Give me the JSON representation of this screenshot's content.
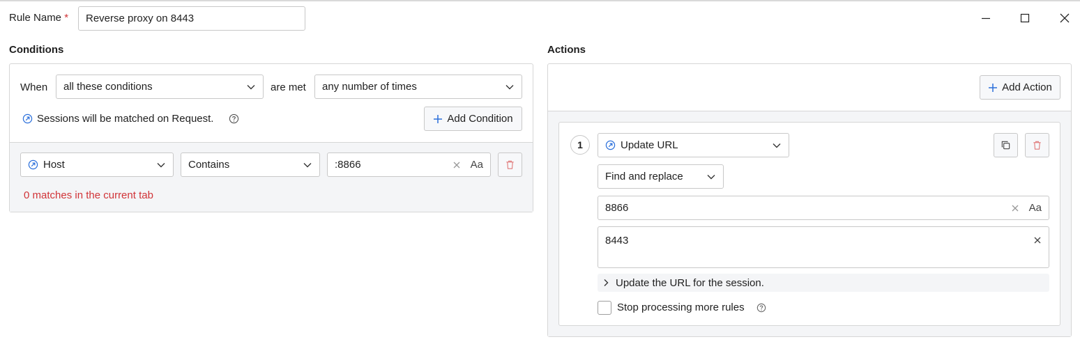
{
  "rule": {
    "name_label": "Rule Name",
    "required_mark": "*",
    "name_value": "Reverse proxy on 8443"
  },
  "window": {
    "minimize_icon": "minimize-icon",
    "maximize_icon": "maximize-icon",
    "close_icon": "close-icon"
  },
  "conditions": {
    "heading": "Conditions",
    "when_label": "When",
    "when_select": "all these conditions",
    "are_met_label": "are met",
    "times_select": "any number of times",
    "sessions_note": "Sessions will be matched on Request.",
    "add_condition_label": "Add Condition",
    "row": {
      "field_select": "Host",
      "operator_select": "Contains",
      "value": ":8866",
      "case_toggle": "Aa"
    },
    "match_status": "0 matches in the current tab"
  },
  "actions": {
    "heading": "Actions",
    "add_action_label": "Add Action",
    "items": [
      {
        "number": "1",
        "type_select": "Update URL",
        "mode_select": "Find and replace",
        "find_value": "8866",
        "case_toggle": "Aa",
        "replace_value": "8443",
        "description": "Update the URL for the session.",
        "stop_label": "Stop processing more rules",
        "stop_checked": false
      }
    ]
  },
  "colors": {
    "accent": "#2a6fdb",
    "error": "#d13438",
    "border": "#c8c8c8"
  }
}
